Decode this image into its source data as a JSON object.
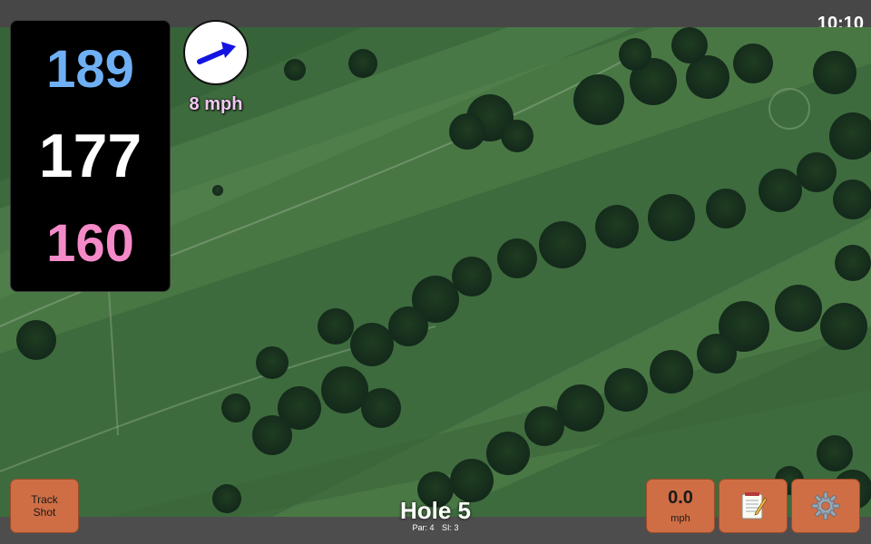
{
  "status": {
    "time": "10:10"
  },
  "distances": {
    "back": "189",
    "middle": "177",
    "front": "160",
    "colors": {
      "back": "#6fb0f5",
      "middle": "#ffffff",
      "front": "#f58ac8"
    }
  },
  "wind": {
    "speed": "8 mph",
    "color": "#f2c8f2",
    "arrow_icon": "wind-direction-arrow"
  },
  "buttons": {
    "track_shot": {
      "line1": "Track",
      "line2": "Shot"
    },
    "speed": {
      "value": "0.0",
      "unit": "mph"
    },
    "notes_icon": "notepad-icon",
    "settings_icon": "gear-icon"
  },
  "hole": {
    "title": "Hole 5",
    "par": "Par: 4",
    "si": "SI: 3"
  },
  "colors": {
    "button_bg": "#cf6e44",
    "map_green": "#3c6a3a"
  }
}
